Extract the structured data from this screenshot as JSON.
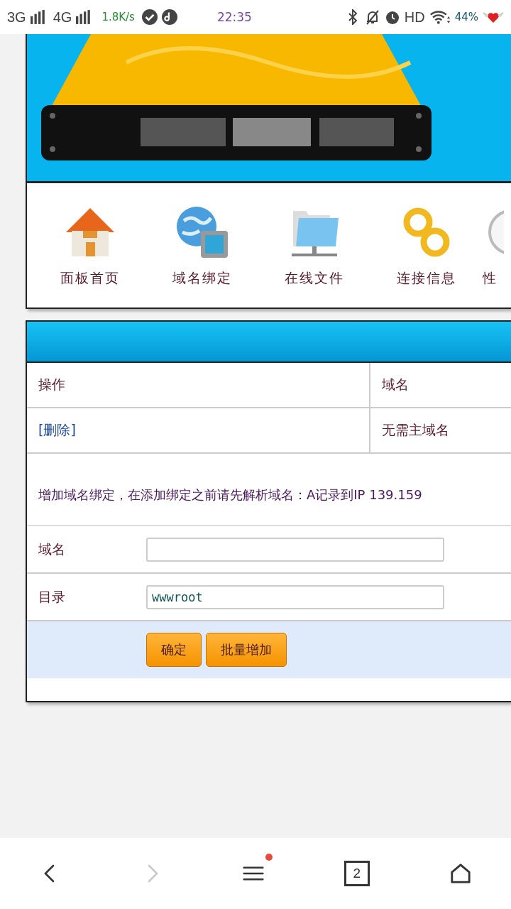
{
  "status_bar": {
    "network_1": "3G",
    "network_2": "4G",
    "speed": "1.8K/s",
    "time": "22:35",
    "hd": "HD",
    "battery": "44%"
  },
  "nav": [
    {
      "label": "面板首页",
      "kind": "home"
    },
    {
      "label": "域名绑定",
      "kind": "globe"
    },
    {
      "label": "在线文件",
      "kind": "folder"
    },
    {
      "label": "连接信息",
      "kind": "link"
    },
    {
      "label": "性",
      "kind": "partial"
    }
  ],
  "table": {
    "columns": [
      "操作",
      "域名"
    ],
    "rows": [
      {
        "action": "[删除]",
        "domain": "无需主域名"
      }
    ]
  },
  "notice": "增加域名绑定，在添加绑定之前请先解析域名：A记录到IP 139.159",
  "form": [
    {
      "label": "域名"
    },
    {
      "label": "目录",
      "value": "wwwroot"
    }
  ],
  "buttons": [
    "确定",
    "批量增加"
  ],
  "browser_bar": {
    "back_disabled": false,
    "forward_disabled": true,
    "menu_notification": true,
    "tab_count": "2"
  }
}
